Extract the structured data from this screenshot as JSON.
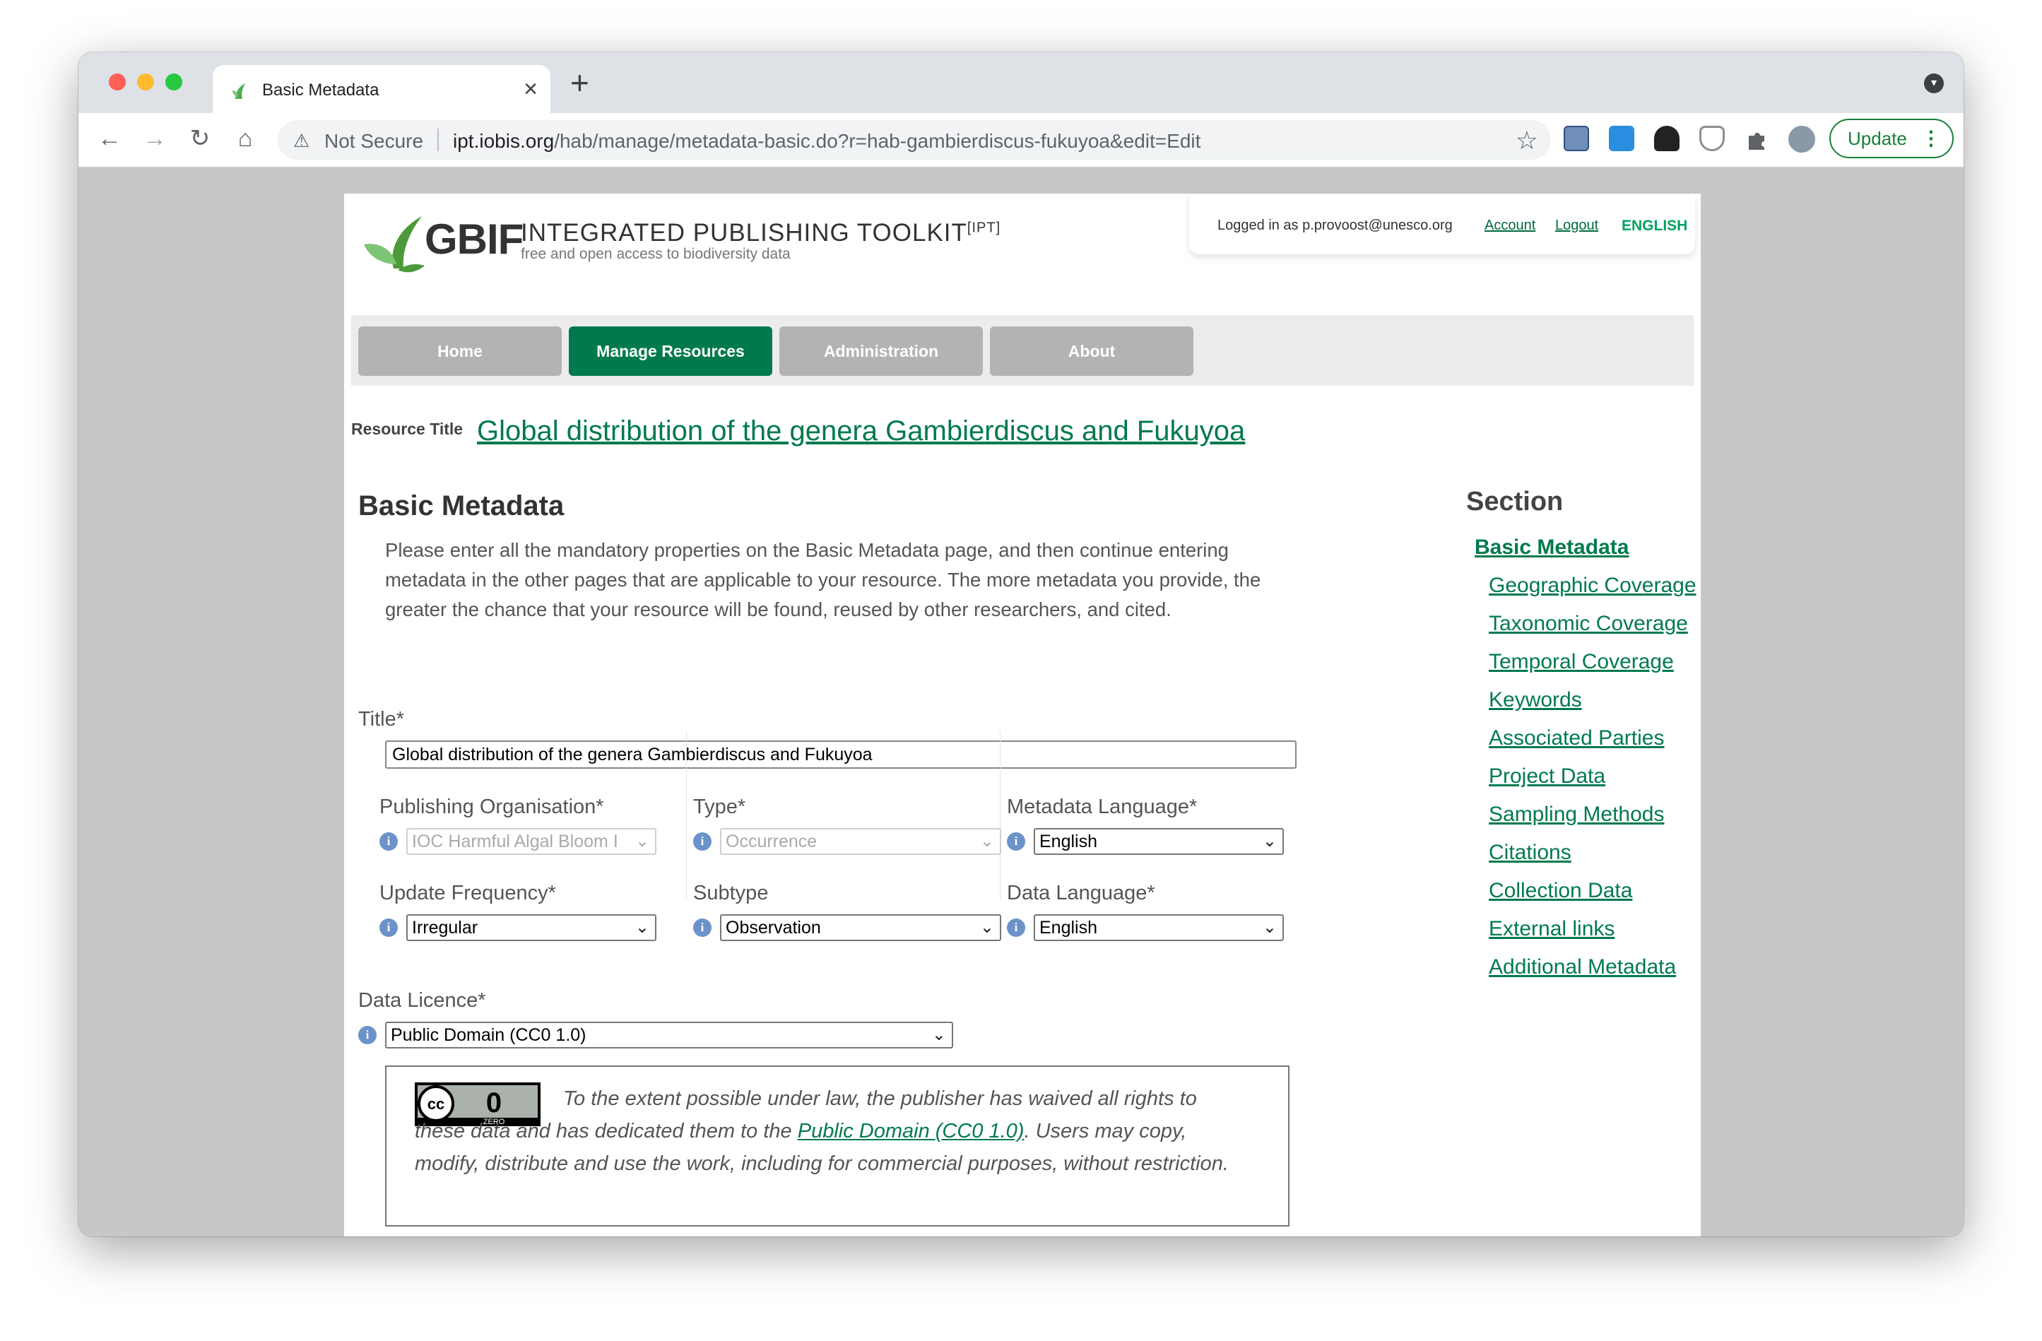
{
  "browser": {
    "tab_title": "Basic Metadata",
    "tab_close": "×",
    "new_tab": "+",
    "security_label": "Not Secure",
    "url_host": "ipt.iobis.org",
    "url_path": "/hab/manage/metadata-basic.do?r=hab-gambierdiscus-fukuyoa&edit=Edit",
    "update_label": "Update",
    "update_menu": "⋮",
    "back": "←",
    "forward": "→",
    "reload": "↻",
    "home": "⌂",
    "star": "☆",
    "warn": "⚠",
    "tab_menu": "▾"
  },
  "header": {
    "logo_text": "GBIF",
    "product_name": "INTEGRATED PUBLISHING TOOLKIT",
    "product_abbr": "[IPT]",
    "tagline": "free and open access to biodiversity data",
    "logged_in": "Logged in as p.provoost@unesco.org",
    "account_label": "Account",
    "logout_label": "Logout",
    "language": "ENGLISH"
  },
  "menu": {
    "items": [
      "Home",
      "Manage Resources",
      "Administration",
      "About"
    ],
    "active": "Manage Resources"
  },
  "resource": {
    "title_label": "Resource Title",
    "title": "Global distribution of the genera Gambierdiscus and Fukuyoa"
  },
  "main": {
    "heading": "Basic Metadata",
    "intro": "Please enter all the mandatory properties on the Basic Metadata page, and then continue entering metadata in the other pages that are applicable to your resource. The more metadata you provide, the greater the chance that your resource will be found, reused by other researchers, and cited."
  },
  "form": {
    "title_label": "Title*",
    "title_value": "Global distribution of the genera Gambierdiscus and Fukuyoa",
    "publishing_org_label": "Publishing Organisation*",
    "publishing_org_value": "IOC Harmful Algal Bloom I",
    "type_label": "Type*",
    "type_value": "Occurrence",
    "metadata_language_label": "Metadata Language*",
    "metadata_language_value": "English",
    "update_frequency_label": "Update Frequency*",
    "update_frequency_value": "Irregular",
    "subtype_label": "Subtype",
    "subtype_value": "Observation",
    "data_language_label": "Data Language*",
    "data_language_value": "English",
    "licence_label": "Data Licence*",
    "licence_value": "Public Domain (CC0 1.0)",
    "info_glyph": "i",
    "caret": "⌄"
  },
  "licence_box": {
    "badge_cc": "cc",
    "badge_zero_digit": "0",
    "badge_zero_word": "ZERO",
    "text_part1": "To the extent possible under law, the publisher has waived all rights to these data and has dedicated them to the",
    "link": "Public Domain (CC0 1.0)",
    "text_part2": ". Users may copy, modify, distribute and use the work, including for commercial purposes, without restriction."
  },
  "sidebar": {
    "title": "Section",
    "items": [
      "Basic Metadata",
      "Geographic Coverage",
      "Taxonomic Coverage",
      "Temporal Coverage",
      "Keywords",
      "Associated Parties",
      "Project Data",
      "Sampling Methods",
      "Citations",
      "Collection Data",
      "External links",
      "Additional Metadata"
    ]
  },
  "colors": {
    "accent": "#007a4d",
    "menu_inactive": "#b3b3b3",
    "window_bg": "#c7c7c7"
  }
}
